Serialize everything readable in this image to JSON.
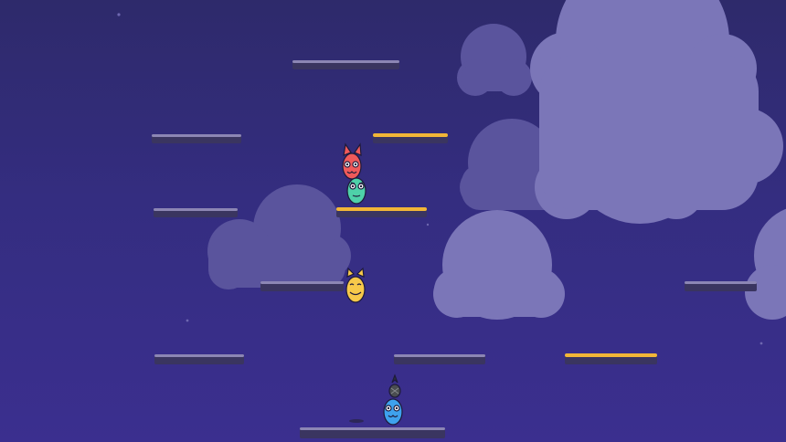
{
  "colors": {
    "sky_top": "#2e2a6b",
    "sky_bottom": "#3b2f8f",
    "cloud_far": "#5b559e",
    "cloud_near": "#7b76b8",
    "platform_normal": "#3a3560",
    "platform_normal_top": "#8c86b4",
    "platform_lit_top": "#f2b637",
    "player_red": "#ef5a5a",
    "player_green": "#4ed1a9",
    "player_yellow": "#f7c94a",
    "player_blue": "#3ea2ee"
  },
  "scene": {
    "platforms": [
      {
        "id": "p1",
        "lit": false
      },
      {
        "id": "p2",
        "lit": false
      },
      {
        "id": "p3",
        "lit": true
      },
      {
        "id": "p4",
        "lit": false
      },
      {
        "id": "p5",
        "lit": true
      },
      {
        "id": "p6",
        "lit": false
      },
      {
        "id": "p7",
        "lit": false
      },
      {
        "id": "p8",
        "lit": false
      },
      {
        "id": "p9",
        "lit": false
      },
      {
        "id": "p10",
        "lit": true
      },
      {
        "id": "p11",
        "lit": false
      }
    ],
    "players": [
      {
        "id": "red",
        "color": "player_red",
        "ears": "cat-ears"
      },
      {
        "id": "green",
        "color": "player_green",
        "ears": "none"
      },
      {
        "id": "yellow",
        "color": "player_yellow",
        "ears": "cat-ears"
      },
      {
        "id": "blue",
        "color": "player_blue",
        "hat": "pineapple-hat"
      }
    ]
  }
}
